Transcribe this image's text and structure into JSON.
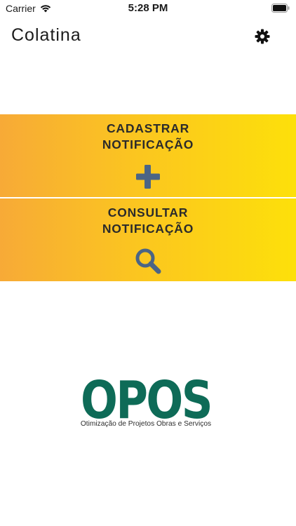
{
  "status_bar": {
    "carrier": "Carrier",
    "time": "5:28 PM"
  },
  "header": {
    "title": "Colatina",
    "settings_icon": "gear-icon"
  },
  "menu": {
    "cadastrar": {
      "label": "CADASTRAR\nNOTIFICAÇÃO",
      "icon": "plus-icon"
    },
    "consultar": {
      "label": "CONSULTAR\nNOTIFICAÇÃO",
      "icon": "search-icon"
    },
    "gradient_start": "#f7aa37",
    "gradient_end": "#fde00a",
    "icon_color": "#4b6585"
  },
  "logo": {
    "text": "OPOS",
    "caption": "Otimização de Projetos Obras e Serviços",
    "color": "#0e6b57"
  }
}
